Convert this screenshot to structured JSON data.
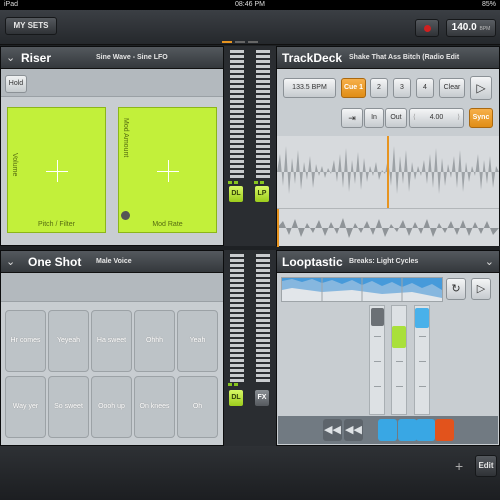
{
  "status_bar": {
    "device": "iPad",
    "time": "08:46 PM",
    "battery": "85%"
  },
  "top_bar": {
    "my_sets_label": "MY SETS",
    "bpm_value": "140.0",
    "bpm_unit": "BPM"
  },
  "riser": {
    "title": "Riser",
    "subtitle": "Sine Wave - Sine LFO",
    "hold_label": "Hold",
    "pad1": {
      "x_label": "Pitch / Filter",
      "y_label": "Volume"
    },
    "pad2": {
      "x_label": "Mod Rate",
      "y_label": "Mod Amount"
    }
  },
  "mixer_top": {
    "left_fader_label": "DL",
    "right_fader_label": "LP"
  },
  "mixer_bottom": {
    "left_fader_label": "DL",
    "right_fader_label": "FX"
  },
  "trackdeck": {
    "title": "TrackDeck",
    "subtitle": "Shake That Ass Bitch (Radio Edit",
    "bpm_label": "133.5 BPM",
    "cues": [
      "Cue 1",
      "2",
      "3",
      "4"
    ],
    "clear_label": "Clear",
    "in_label": "In",
    "out_label": "Out",
    "loop_value": "4.00",
    "sync_label": "Sync"
  },
  "oneshot": {
    "title": "One Shot",
    "subtitle": "Male Voice",
    "pads": [
      "Hr comes",
      "Yeyeah",
      "Ha sweet",
      "Ohhh",
      "Yeah",
      "Way yer",
      "So sweet",
      "Oooh up",
      "On knees",
      "Oh"
    ]
  },
  "looptastic": {
    "title": "Looptastic",
    "subtitle": "Breaks: Light Cycles"
  },
  "bottom_bar": {
    "add_label": "+",
    "edit_label": "Edit"
  },
  "colors": {
    "accent_orange": "#e79420",
    "pad_lime": "#c2f03a",
    "loop_blue": "#39a7e4",
    "loop_red": "#e2531c"
  }
}
